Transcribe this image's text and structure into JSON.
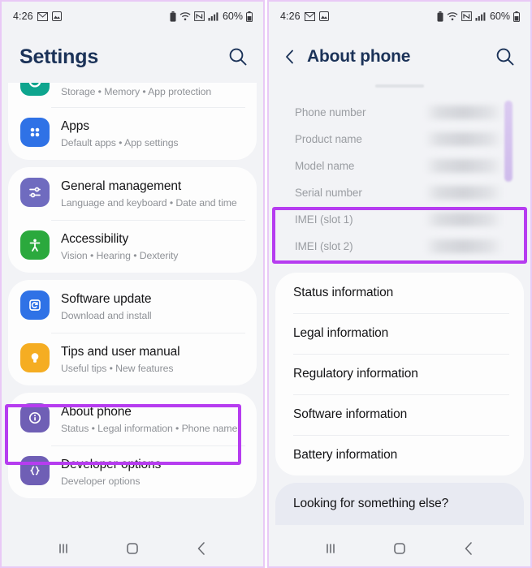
{
  "statusbar": {
    "time": "4:26",
    "battery_percent": "60%",
    "icons": [
      "gmail-icon",
      "photos-icon",
      "battery-saver-icon",
      "wifi-icon",
      "nfc-icon",
      "signal-bars-icon",
      "battery-icon"
    ]
  },
  "left_panel": {
    "title": "Settings",
    "search_icon": "search-icon",
    "groups": [
      {
        "items": [
          {
            "title": "",
            "subtitle": "Storage  •  Memory  •  App protection",
            "icon": "device-care-icon",
            "icon_color": "#0ea58e",
            "clipped": true
          },
          {
            "title": "Apps",
            "subtitle": "Default apps  •  App settings",
            "icon": "apps-grid-icon",
            "icon_color": "#2f72e6",
            "clipped": false
          }
        ]
      },
      {
        "items": [
          {
            "title": "General management",
            "subtitle": "Language and keyboard  •  Date and time",
            "icon": "sliders-icon",
            "icon_color": "#6f6bbf",
            "clipped": false
          },
          {
            "title": "Accessibility",
            "subtitle": "Vision  •  Hearing  •  Dexterity",
            "icon": "accessibility-icon",
            "icon_color": "#2ba93d",
            "clipped": false
          }
        ]
      },
      {
        "items": [
          {
            "title": "Software update",
            "subtitle": "Download and install",
            "icon": "software-update-icon",
            "icon_color": "#2f72e6",
            "clipped": false
          },
          {
            "title": "Tips and user manual",
            "subtitle": "Useful tips  •  New features",
            "icon": "lightbulb-icon",
            "icon_color": "#f5ad22",
            "clipped": false
          }
        ]
      },
      {
        "items": [
          {
            "title": "About phone",
            "subtitle": "Status  •  Legal information  •  Phone name",
            "icon": "info-circle-icon",
            "icon_color": "#6f5fb5",
            "clipped": false
          },
          {
            "title": "Developer options",
            "subtitle": "Developer options",
            "icon": "curly-braces-icon",
            "icon_color": "#6f5fb5",
            "clipped": false
          }
        ]
      }
    ]
  },
  "right_panel": {
    "title": "About phone",
    "back_icon": "back-chevron-icon",
    "search_icon": "search-icon",
    "info_rows": [
      {
        "label": "Phone number"
      },
      {
        "label": "Product name"
      },
      {
        "label": "Model name"
      },
      {
        "label": "Serial number"
      },
      {
        "label": "IMEI (slot 1)"
      },
      {
        "label": "IMEI (slot 2)"
      }
    ],
    "list_rows": [
      {
        "label": "Status information"
      },
      {
        "label": "Legal information"
      },
      {
        "label": "Regulatory information"
      },
      {
        "label": "Software information"
      },
      {
        "label": "Battery information"
      }
    ],
    "footer": {
      "label": "Looking for something else?"
    }
  },
  "navbar": {
    "recents_icon": "recents-icon",
    "home_icon": "home-icon",
    "back_icon": "back-icon"
  },
  "annotations": {
    "highlight_color": "#b63cf0",
    "about_phone_box": "highlight-about-phone",
    "imei_box": "highlight-imei-rows"
  }
}
